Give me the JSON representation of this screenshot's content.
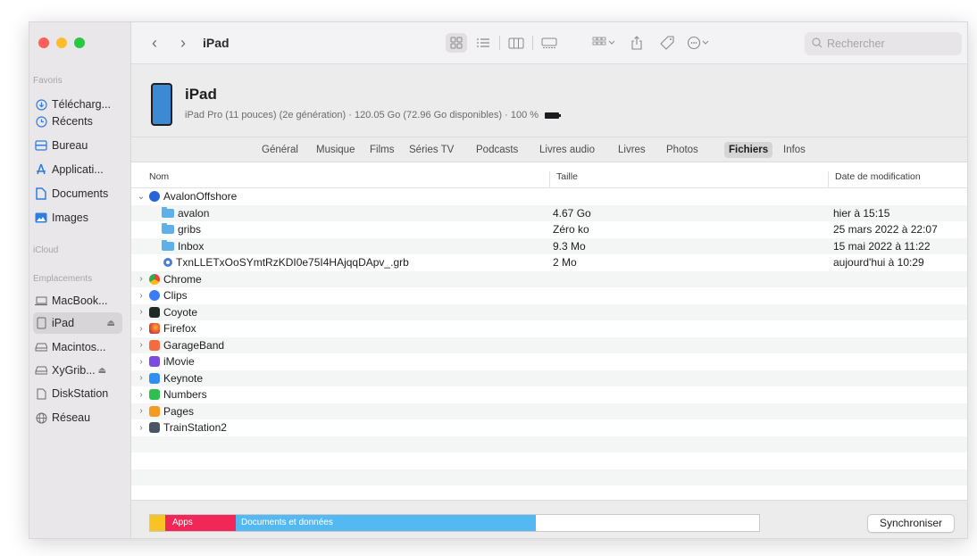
{
  "toolbar": {
    "back": "‹",
    "forward": "›",
    "title": "iPad",
    "search_placeholder": "Rechercher"
  },
  "sidebar": {
    "favoris": "Favoris",
    "icloud": "iCloud",
    "emplacements": "Emplacements",
    "favorites": [
      {
        "label": "Télécharg...",
        "icon": "download-icon"
      },
      {
        "label": "Récents",
        "icon": "clock-icon"
      },
      {
        "label": "Bureau",
        "icon": "desktop-icon"
      },
      {
        "label": "Applicati...",
        "icon": "applications-icon"
      },
      {
        "label": "Documents",
        "icon": "document-icon"
      },
      {
        "label": "Images",
        "icon": "images-icon"
      }
    ],
    "locations": [
      {
        "label": "MacBook...",
        "icon": "laptop-icon"
      },
      {
        "label": "iPad",
        "icon": "ipad-icon",
        "eject": "⏏"
      },
      {
        "label": "Macintos...",
        "icon": "disk-icon"
      },
      {
        "label": "XyGrib...",
        "icon": "disk-icon",
        "eject": "⏏"
      },
      {
        "label": "DiskStation",
        "icon": "server-icon"
      },
      {
        "label": "Réseau",
        "icon": "network-icon"
      }
    ]
  },
  "device": {
    "name": "iPad",
    "description": "iPad Pro (11 pouces) (2e génération) · 120.05 Go (72.96 Go disponibles) · 100 %"
  },
  "tabs": [
    "Général",
    "Musique",
    "Films",
    "Séries TV",
    "Podcasts",
    "Livres audio",
    "Livres",
    "Photos",
    "Fichiers",
    "Infos"
  ],
  "active_tab": "Fichiers",
  "columns": {
    "name": "Nom",
    "size": "Taille",
    "date": "Date de modification"
  },
  "rows": [
    {
      "name": "AvalonOffshore",
      "size": "",
      "date": ""
    },
    {
      "name": "avalon",
      "size": "4.67 Go",
      "date": "hier à 15:15"
    },
    {
      "name": "gribs",
      "size": "Zéro ko",
      "date": "25 mars 2022 à 22:07"
    },
    {
      "name": "Inbox",
      "size": "9.3 Mo",
      "date": "15 mai 2022 à 11:22"
    },
    {
      "name": "TxnLLETxOoSYmtRzKDI0e75I4HAjqqDApv_.grb",
      "size": "2 Mo",
      "date": "aujourd'hui à 10:29"
    },
    {
      "name": "Chrome",
      "size": "",
      "date": ""
    },
    {
      "name": "Clips",
      "size": "",
      "date": ""
    },
    {
      "name": "Coyote",
      "size": "",
      "date": ""
    },
    {
      "name": "Firefox",
      "size": "",
      "date": ""
    },
    {
      "name": "GarageBand",
      "size": "",
      "date": ""
    },
    {
      "name": "iMovie",
      "size": "",
      "date": ""
    },
    {
      "name": "Keynote",
      "size": "",
      "date": ""
    },
    {
      "name": "Numbers",
      "size": "",
      "date": ""
    },
    {
      "name": "Pages",
      "size": "",
      "date": ""
    },
    {
      "name": "TrainStation2",
      "size": "",
      "date": ""
    }
  ],
  "storage": {
    "apps": "Apps",
    "docs": "Documents et données"
  },
  "sync_label": "Synchroniser",
  "colors": {
    "apps": "#f12857",
    "docs": "#54b9f2",
    "other": "#f7c325",
    "folder": "#5fb0e8"
  }
}
